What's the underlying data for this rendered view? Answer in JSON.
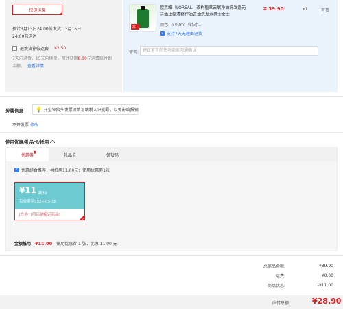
{
  "shipping": {
    "method_label": "快递运输",
    "note_line1": "预计3月13日24:00前发货，3月15日",
    "note_line2": "24:00前送达",
    "insurance_label": "退换货补偿运费",
    "insurance_price": "¥2.50",
    "insurance_desc_pre": "7天内退货，15天内换货，预计获得",
    "insurance_desc_amount": "8.00",
    "insurance_desc_post": "元运费赔付到",
    "insurance_desc_line2": "余额。",
    "insurance_link": "查看详情"
  },
  "product": {
    "title": "欧莱雅（LOREAL）茶树植萃去屑净油洗发露无硅油止痒清爽控油去油洗发水男士女士",
    "spec": "颜色：500ml（针对...",
    "service": "支持7天无理由退货",
    "service_icon": "7",
    "badge": "35+",
    "price": "¥ 39.90",
    "qty": "x1",
    "stock": "有货",
    "memo_label": "留言:",
    "memo_placeholder": "建议留言前先与商家沟通确认"
  },
  "invoice": {
    "label": "发票信息",
    "tip": "开企业抬头发票须填写纳税人识别号，以免影响报销",
    "status": "不开发票",
    "edit_link": "修改"
  },
  "coupons": {
    "title": "使用优惠/礼品卡/抵用",
    "tabs": [
      "优惠券",
      "礼品卡",
      "领货码"
    ],
    "active_star": "●",
    "combo_text": "优惠组合推荐，共抵用11.00元；使用优惠券1张",
    "card": {
      "amount": "¥11",
      "condition": "满39",
      "expiry": "有效期至2024-03-18",
      "scope": "[东券]  [限店铺指定商品]"
    },
    "discount_label": "金额抵用",
    "discount_amount": "¥11.00",
    "discount_desc": "使用优惠券 1 张，优惠 11.00 元"
  },
  "summary": {
    "rows": [
      {
        "label": "总商品金额:",
        "value": "¥39.90"
      },
      {
        "label": "运费:",
        "value": "¥0.00"
      },
      {
        "label": "商品优惠:",
        "value": "-¥11.00"
      }
    ],
    "payable_label": "应付总额:",
    "payable_amount": "¥28.90"
  },
  "colors": {
    "accent": "#e02020",
    "link": "#3478f6",
    "coupon": "#6ccad0"
  }
}
